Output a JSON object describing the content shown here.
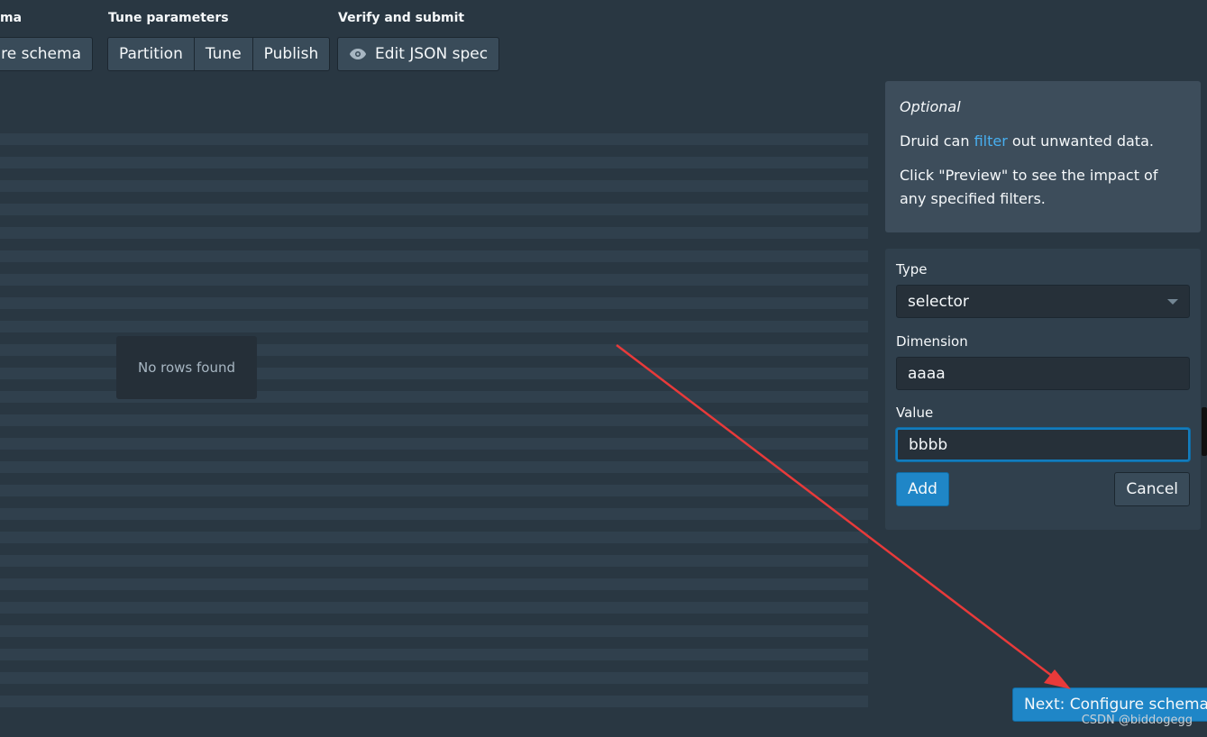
{
  "steps": {
    "schema": {
      "title": "ma",
      "button": "ure schema"
    },
    "tune": {
      "title": "Tune parameters",
      "buttons": [
        "Partition",
        "Tune",
        "Publish"
      ]
    },
    "verify": {
      "title": "Verify and submit",
      "button": "Edit JSON spec",
      "icon": "eye-icon"
    }
  },
  "table": {
    "empty_text": "No rows found"
  },
  "info": {
    "heading": "Optional",
    "line1_pre": "Druid can ",
    "line1_link": "filter",
    "line1_post": " out unwanted data.",
    "line2": "Click \"Preview\" to see the impact of any specified filters."
  },
  "form": {
    "type_label": "Type",
    "type_value": "selector",
    "dimension_label": "Dimension",
    "dimension_value": "aaaa",
    "value_label": "Value",
    "value_value": "bbbb",
    "add": "Add",
    "cancel": "Cancel"
  },
  "next_button": "Next: Configure schema",
  "watermark": "CSDN @biddogegg",
  "colors": {
    "accent": "#1f86c7",
    "link": "#48aff0",
    "annotation_arrow": "#e83a3a"
  }
}
